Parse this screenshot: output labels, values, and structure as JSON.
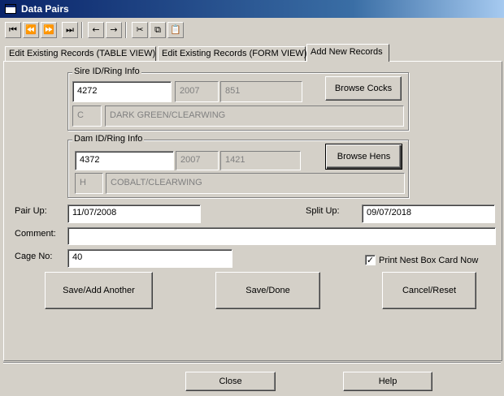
{
  "window": {
    "title": "Data Pairs"
  },
  "toolbar": {
    "first": "⏮",
    "prev": "⏪",
    "next": "⏩",
    "last": "⏭",
    "back": "←",
    "forward": "→",
    "cut": "✂",
    "copy": "⧉",
    "paste": "📋"
  },
  "tabs": [
    {
      "label": "Edit Existing Records (TABLE VIEW)"
    },
    {
      "label": "Edit Existing Records (FORM VIEW)"
    },
    {
      "label": "Add New Records"
    }
  ],
  "sire": {
    "legend": "Sire ID/Ring Info",
    "id": "4272",
    "year": "2007",
    "ring": "851",
    "code": "C",
    "color": "DARK GREEN/CLEARWING",
    "browse_label": "Browse Cocks"
  },
  "dam": {
    "legend": "Dam ID/Ring Info",
    "id": "4372",
    "year": "2007",
    "ring": "1421",
    "code": "H",
    "color": "COBALT/CLEARWING",
    "browse_label": "Browse Hens"
  },
  "form": {
    "pair_up_label": "Pair Up:",
    "pair_up_value": "11/07/2008",
    "split_up_label": "Split Up:",
    "split_up_value": "09/07/2018",
    "comment_label": "Comment:",
    "comment_value": "",
    "cage_label": "Cage No:",
    "cage_value": "40",
    "print_nest_label": "Print Nest Box Card Now",
    "print_nest_checked": true
  },
  "actions": {
    "save_add": "Save/Add Another",
    "save_done": "Save/Done",
    "cancel_reset": "Cancel/Reset"
  },
  "footer": {
    "close": "Close",
    "help": "Help"
  }
}
